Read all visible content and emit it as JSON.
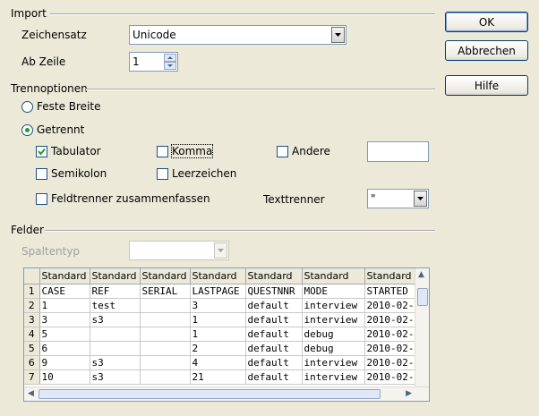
{
  "import": {
    "group_label": "Import",
    "charset_label": "Zeichensatz",
    "charset_value": "Unicode",
    "from_row_label": "Ab Zeile",
    "from_row_value": "1"
  },
  "buttons": {
    "ok": "OK",
    "cancel": "Abbrechen",
    "help": "Hilfe"
  },
  "separator": {
    "group_label": "Trennoptionen",
    "fixed_width": "Feste Breite",
    "separated": "Getrennt",
    "mode": "separated",
    "tab": "Tabulator",
    "tab_checked": true,
    "comma": "Komma",
    "comma_checked": false,
    "other": "Andere",
    "other_checked": false,
    "other_value": "",
    "semicolon": "Semikolon",
    "semicolon_checked": false,
    "space": "Leerzeichen",
    "space_checked": false,
    "merge": "Feldtrenner zusammenfassen",
    "merge_checked": false,
    "text_delimiter_label": "Texttrenner",
    "text_delimiter_value": "\""
  },
  "fields": {
    "group_label": "Felder",
    "column_type_label": "Spaltentyp",
    "column_type_value": ""
  },
  "preview": {
    "headers": [
      "Standard",
      "Standard",
      "Standard",
      "Standard",
      "Standard",
      "Standard",
      "Standard"
    ],
    "rows": [
      {
        "num": "1",
        "cells": [
          "CASE",
          "REF",
          "SERIAL",
          "LASTPAGE",
          "QUESTNNR",
          "MODE",
          "STARTED"
        ]
      },
      {
        "num": "2",
        "cells": [
          "1",
          "test",
          "",
          "3",
          "default",
          "interview",
          "2010-02-"
        ]
      },
      {
        "num": "3",
        "cells": [
          "3",
          "s3",
          "",
          "1",
          "default",
          "interview",
          "2010-02-"
        ]
      },
      {
        "num": "4",
        "cells": [
          "5",
          "",
          "",
          "1",
          "default",
          "debug",
          "2010-02-"
        ]
      },
      {
        "num": "5",
        "cells": [
          "6",
          "",
          "",
          "2",
          "default",
          "debug",
          "2010-02-"
        ]
      },
      {
        "num": "6",
        "cells": [
          "9",
          "s3",
          "",
          "4",
          "default",
          "interview",
          "2010-02-"
        ]
      },
      {
        "num": "7",
        "cells": [
          "10",
          "s3",
          "",
          "21",
          "default",
          "interview",
          "2010-02-"
        ]
      }
    ]
  },
  "icons": {
    "dropdown": "chevron-down-icon",
    "spin_up": "arrow-up-icon",
    "spin_down": "arrow-down-icon",
    "check": "checkmark-icon"
  }
}
